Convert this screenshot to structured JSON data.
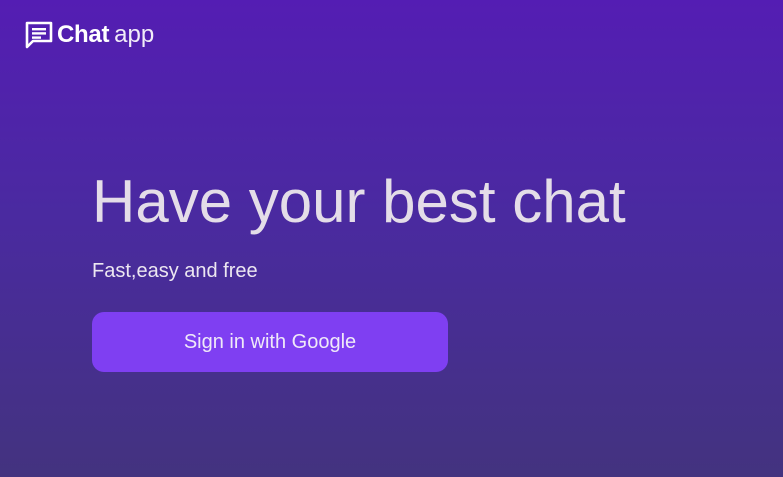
{
  "header": {
    "logo_icon": "chat-bubble-icon",
    "brand_bold": "Chat",
    "brand_light": "app"
  },
  "hero": {
    "title": "Have your best chat",
    "subtitle": "Fast,easy and free",
    "signin_label": "Sign in with Google"
  },
  "colors": {
    "background_top": "#541db3",
    "background_bottom": "#43337f",
    "button": "#7f3ff2"
  }
}
